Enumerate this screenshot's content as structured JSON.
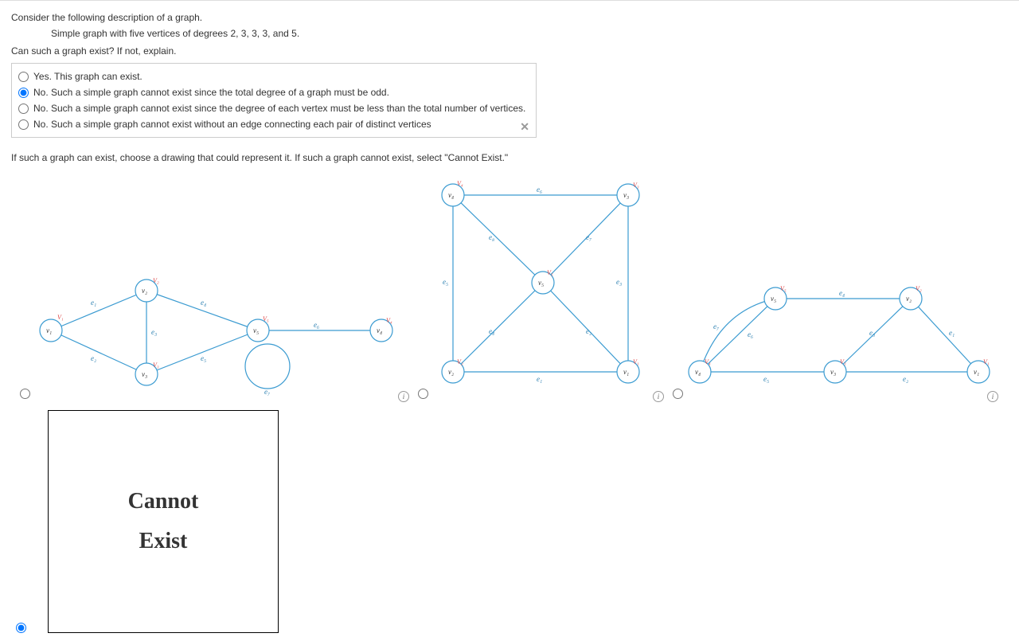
{
  "question": {
    "prompt": "Consider the following description of a graph.",
    "description": "Simple graph with five vertices of degrees 2, 3, 3, 3, and 5.",
    "subprompt": "Can such a graph exist? If not, explain."
  },
  "mc": {
    "options": [
      {
        "label": "Yes. This graph can exist.",
        "selected": false
      },
      {
        "label": "No. Such a simple graph cannot exist since the total degree of a graph must be odd.",
        "selected": true
      },
      {
        "label": "No. Such a simple graph cannot exist since the degree of each vertex must be less than the total number of vertices.",
        "selected": false
      },
      {
        "label": "No. Such a simple graph cannot exist without an edge connecting each pair of distinct vertices",
        "selected": false
      }
    ],
    "close_glyph": "✕"
  },
  "drawing_prompt": "If such a graph can exist, choose a drawing that could represent it. If such a graph cannot exist, select \"Cannot Exist.\"",
  "graph_selection": {
    "selected_index": 3,
    "graphs": [
      {
        "vertices": {
          "v1": "v₁",
          "v2": "v₂",
          "v3": "v₃",
          "v4": "v₄",
          "v5": "v₅"
        },
        "tags": {
          "t1": "V₁",
          "t2": "V₂",
          "t3": "V₃",
          "t4": "V₄",
          "t5": "V₅"
        },
        "edges": {
          "e1": "e₁",
          "e2": "e₂",
          "e3": "e₃",
          "e4": "e₄",
          "e5": "e₅",
          "e6": "e₆",
          "e7": "e₇"
        }
      },
      {
        "vertices": {
          "v1": "v₁",
          "v2": "v₂",
          "v3": "v₃",
          "v4": "v₄",
          "v5": "v₅"
        },
        "tags": {
          "t1": "V₁",
          "t2": "V₂",
          "t3": "V₃",
          "t4": "V₄",
          "t5": "V₅"
        },
        "edges": {
          "e1": "e₁",
          "e2": "e₂",
          "e3": "e₃",
          "e4": "e₄",
          "e5": "e₅",
          "e6": "e₆",
          "e7": "e₇",
          "e8": "e₈"
        }
      },
      {
        "vertices": {
          "v1": "v₁",
          "v2": "v₂",
          "v3": "v₃",
          "v4": "v₄",
          "v5": "v₅"
        },
        "tags": {
          "t1": "V₁",
          "t2": "V₂",
          "t3": "V₃",
          "t4": "V₄",
          "t5": "V₅"
        },
        "edges": {
          "e1": "e₁",
          "e2": "e₂",
          "e3": "e₃",
          "e4": "e₄",
          "e5": "e₅",
          "e6": "e₆",
          "e7": "e₇"
        }
      }
    ],
    "cannot_exist": {
      "line1": "Cannot",
      "line2": "Exist"
    }
  },
  "info_glyph": "i"
}
